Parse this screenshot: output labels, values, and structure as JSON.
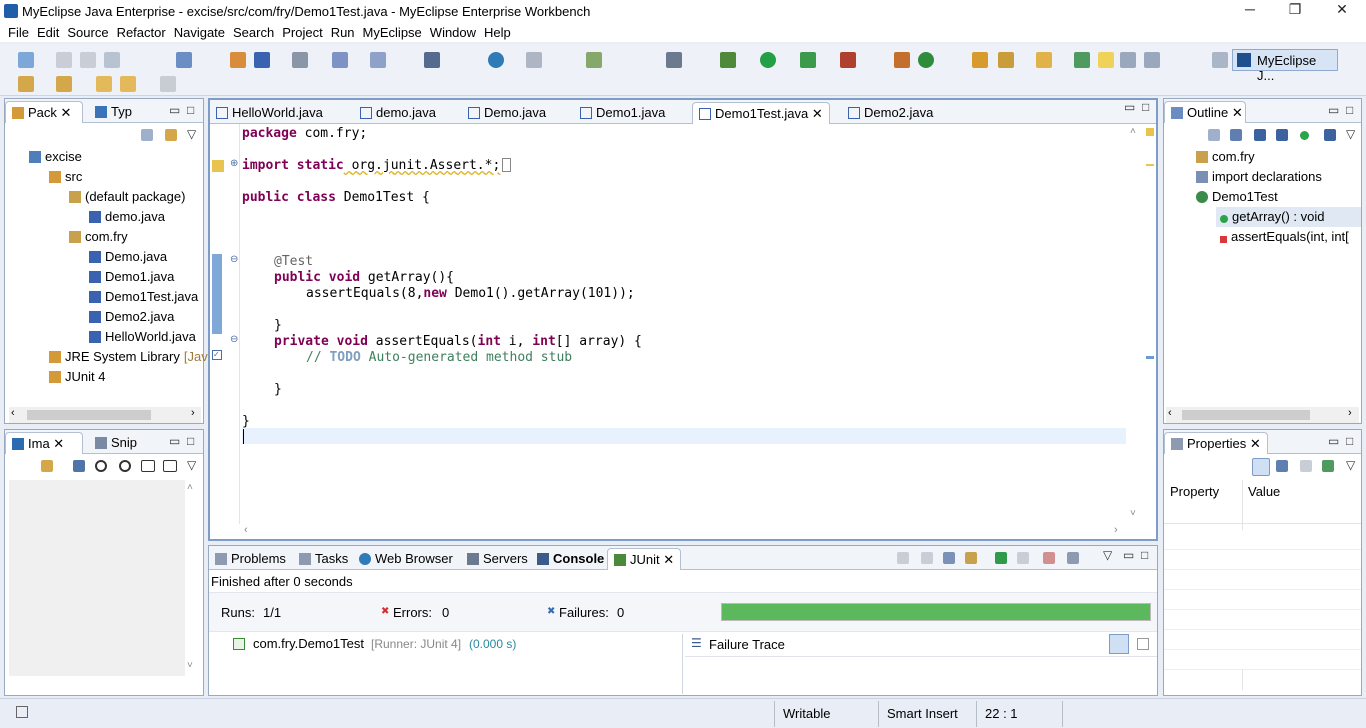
{
  "window": {
    "title": "MyEclipse Java Enterprise - excise/src/com/fry/Demo1Test.java - MyEclipse Enterprise Workbench"
  },
  "menu": [
    "File",
    "Edit",
    "Source",
    "Refactor",
    "Navigate",
    "Search",
    "Project",
    "Run",
    "MyEclipse",
    "Window",
    "Help"
  ],
  "perspective": {
    "label": "MyEclipse J..."
  },
  "left_top": {
    "tabs": [
      "Pack",
      "Typ"
    ],
    "tree": [
      {
        "label": "excise",
        "indent": 0
      },
      {
        "label": "src",
        "indent": 1
      },
      {
        "label": "(default package)",
        "indent": 2
      },
      {
        "label": "demo.java",
        "indent": 3
      },
      {
        "label": "com.fry",
        "indent": 2
      },
      {
        "label": "Demo.java",
        "indent": 3
      },
      {
        "label": "Demo1.java",
        "indent": 3
      },
      {
        "label": "Demo1Test.java",
        "indent": 3
      },
      {
        "label": "Demo2.java",
        "indent": 3
      },
      {
        "label": "HelloWorld.java",
        "indent": 3
      },
      {
        "label": "JRE System Library",
        "suffix": "[Jav",
        "indent": 1
      },
      {
        "label": "JUnit 4",
        "indent": 1
      }
    ]
  },
  "left_bottom": {
    "tabs": [
      "Ima",
      "Snip"
    ]
  },
  "editor": {
    "tabs": [
      "HelloWorld.java",
      "demo.java",
      "Demo.java",
      "Demo1.java",
      "Demo1Test.java",
      "Demo2.java"
    ],
    "active_tab": "Demo1Test.java",
    "code": {
      "l1a": "package",
      "l1b": " com.fry;",
      "l2a": "import static",
      "l2b": " org.junit.Assert.*;",
      "l3a": "public class",
      "l3b": " Demo1Test {",
      "l4": "@Test",
      "l5a": "public void",
      "l5b": " getArray(){",
      "l6a": "assertEquals(8,",
      "l6b": "new",
      "l6c": " Demo1().getArray(101));",
      "l7": "}",
      "l8a": "private void",
      "l8b": " assertEquals(",
      "l8c": "int",
      "l8d": " i, ",
      "l8e": "int",
      "l8f": "[] array) {",
      "l9a": "// ",
      "l9b": "TODO",
      "l9c": " Auto-generated method stub",
      "l10": "}",
      "l11": "}"
    }
  },
  "outline": {
    "tab": "Outline",
    "items": [
      "com.fry",
      "import declarations",
      "Demo1Test",
      "getArray() : void",
      "assertEquals(int, int["
    ]
  },
  "properties": {
    "tab": "Properties",
    "col1": "Property",
    "col2": "Value"
  },
  "bottom": {
    "tabs": [
      "Problems",
      "Tasks",
      "Web Browser",
      "Servers",
      "Console",
      "JUnit"
    ],
    "finished": "Finished after 0 seconds",
    "runs_label": "Runs:",
    "runs": "1/1",
    "errors_label": "Errors:",
    "errors": "0",
    "failures_label": "Failures:",
    "failures": "0",
    "progress": 1.0,
    "test_name": "com.fry.Demo1Test",
    "test_runner": "[Runner: JUnit 4]",
    "test_time": "(0.000 s)",
    "failure_trace": "Failure Trace"
  },
  "status": {
    "writable": "Writable",
    "insert": "Smart Insert",
    "position": "22 : 1"
  },
  "colors": {
    "progress": "#5cb85c",
    "keyword": "#7f0055",
    "comment": "#3f7f5f"
  }
}
